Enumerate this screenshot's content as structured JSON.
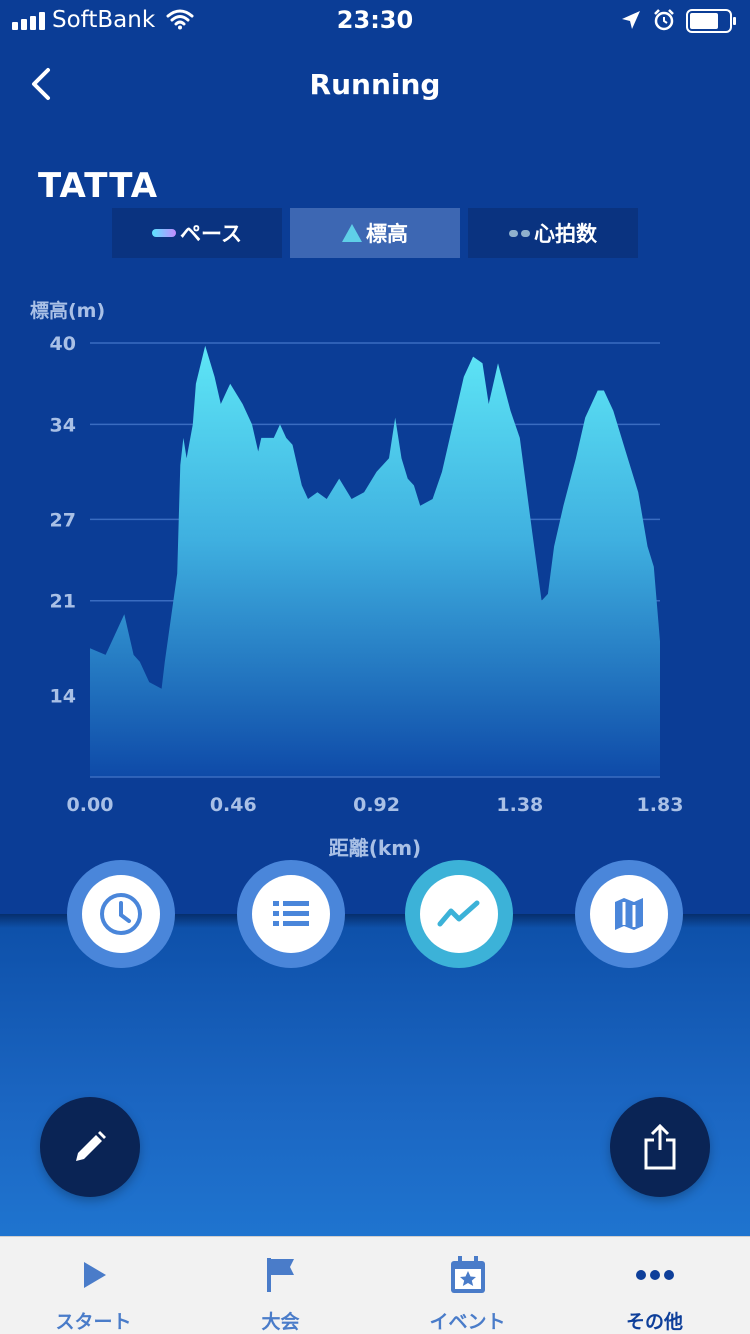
{
  "status_bar": {
    "carrier": "SoftBank",
    "time": "23:30"
  },
  "nav": {
    "title": "Running"
  },
  "logo_text": "TATTA",
  "tabs": [
    {
      "label": "ペース",
      "active": false
    },
    {
      "label": "標高",
      "active": true
    },
    {
      "label": "心拍数",
      "active": false
    }
  ],
  "chart_data": {
    "type": "area",
    "ylabel": "標高(m)",
    "xlabel": "距離(km)",
    "y_ticks": [
      "40",
      "34",
      "27",
      "21",
      "14"
    ],
    "y_tick_values": [
      40,
      34,
      27,
      21,
      14
    ],
    "x_ticks": [
      "0.00",
      "0.46",
      "0.92",
      "1.38",
      "1.83"
    ],
    "x_tick_values": [
      0,
      0.46,
      0.92,
      1.38,
      1.83
    ],
    "xlim": [
      0,
      1.83
    ],
    "ylim": [
      8,
      40
    ],
    "grid": true,
    "fill_color_top": "#5ee6f6",
    "fill_color_bottom": "#0e4aa8",
    "x": [
      0,
      0.05,
      0.11,
      0.14,
      0.16,
      0.19,
      0.23,
      0.24,
      0.28,
      0.29,
      0.3,
      0.31,
      0.33,
      0.34,
      0.37,
      0.4,
      0.42,
      0.44,
      0.45,
      0.49,
      0.5,
      0.52,
      0.54,
      0.55,
      0.59,
      0.61,
      0.63,
      0.65,
      0.68,
      0.7,
      0.73,
      0.76,
      0.8,
      0.84,
      0.88,
      0.92,
      0.96,
      0.98,
      1.0,
      1.02,
      1.04,
      1.06,
      1.1,
      1.13,
      1.16,
      1.2,
      1.23,
      1.26,
      1.28,
      1.31,
      1.35,
      1.38,
      1.42,
      1.45,
      1.47,
      1.49,
      1.52,
      1.56,
      1.59,
      1.63,
      1.65,
      1.68,
      1.72,
      1.76,
      1.79,
      1.81,
      1.83
    ],
    "y": [
      17.5,
      17,
      20,
      17,
      16.5,
      15,
      14.5,
      16.5,
      23,
      31,
      33,
      31.5,
      34,
      37,
      39.8,
      37.5,
      35.5,
      36.5,
      37,
      35.5,
      35,
      34,
      32,
      33,
      33,
      34,
      33,
      32.5,
      29.5,
      28.5,
      29,
      28.5,
      30,
      28.5,
      29,
      30.5,
      31.5,
      34.5,
      31.5,
      30,
      29.5,
      28,
      28.5,
      30.5,
      33.5,
      37.5,
      39,
      38.5,
      35.5,
      38.5,
      35,
      33,
      26,
      21,
      21.5,
      25,
      28,
      31.5,
      34.5,
      36.5,
      36.5,
      35,
      32,
      29,
      25,
      23.5,
      18
    ]
  },
  "buttons": {
    "clock": "clock-icon",
    "list": "list-icon",
    "chart": "line-chart-icon",
    "map": "map-icon",
    "edit": "pencil-icon",
    "share": "share-icon"
  },
  "tab_bar": [
    {
      "label": "スタート",
      "icon": "play-icon",
      "active": false
    },
    {
      "label": "大会",
      "icon": "flag-icon",
      "active": false
    },
    {
      "label": "イベント",
      "icon": "calendar-star-icon",
      "active": false
    },
    {
      "label": "その他",
      "icon": "more-dots-icon",
      "active": true
    }
  ]
}
